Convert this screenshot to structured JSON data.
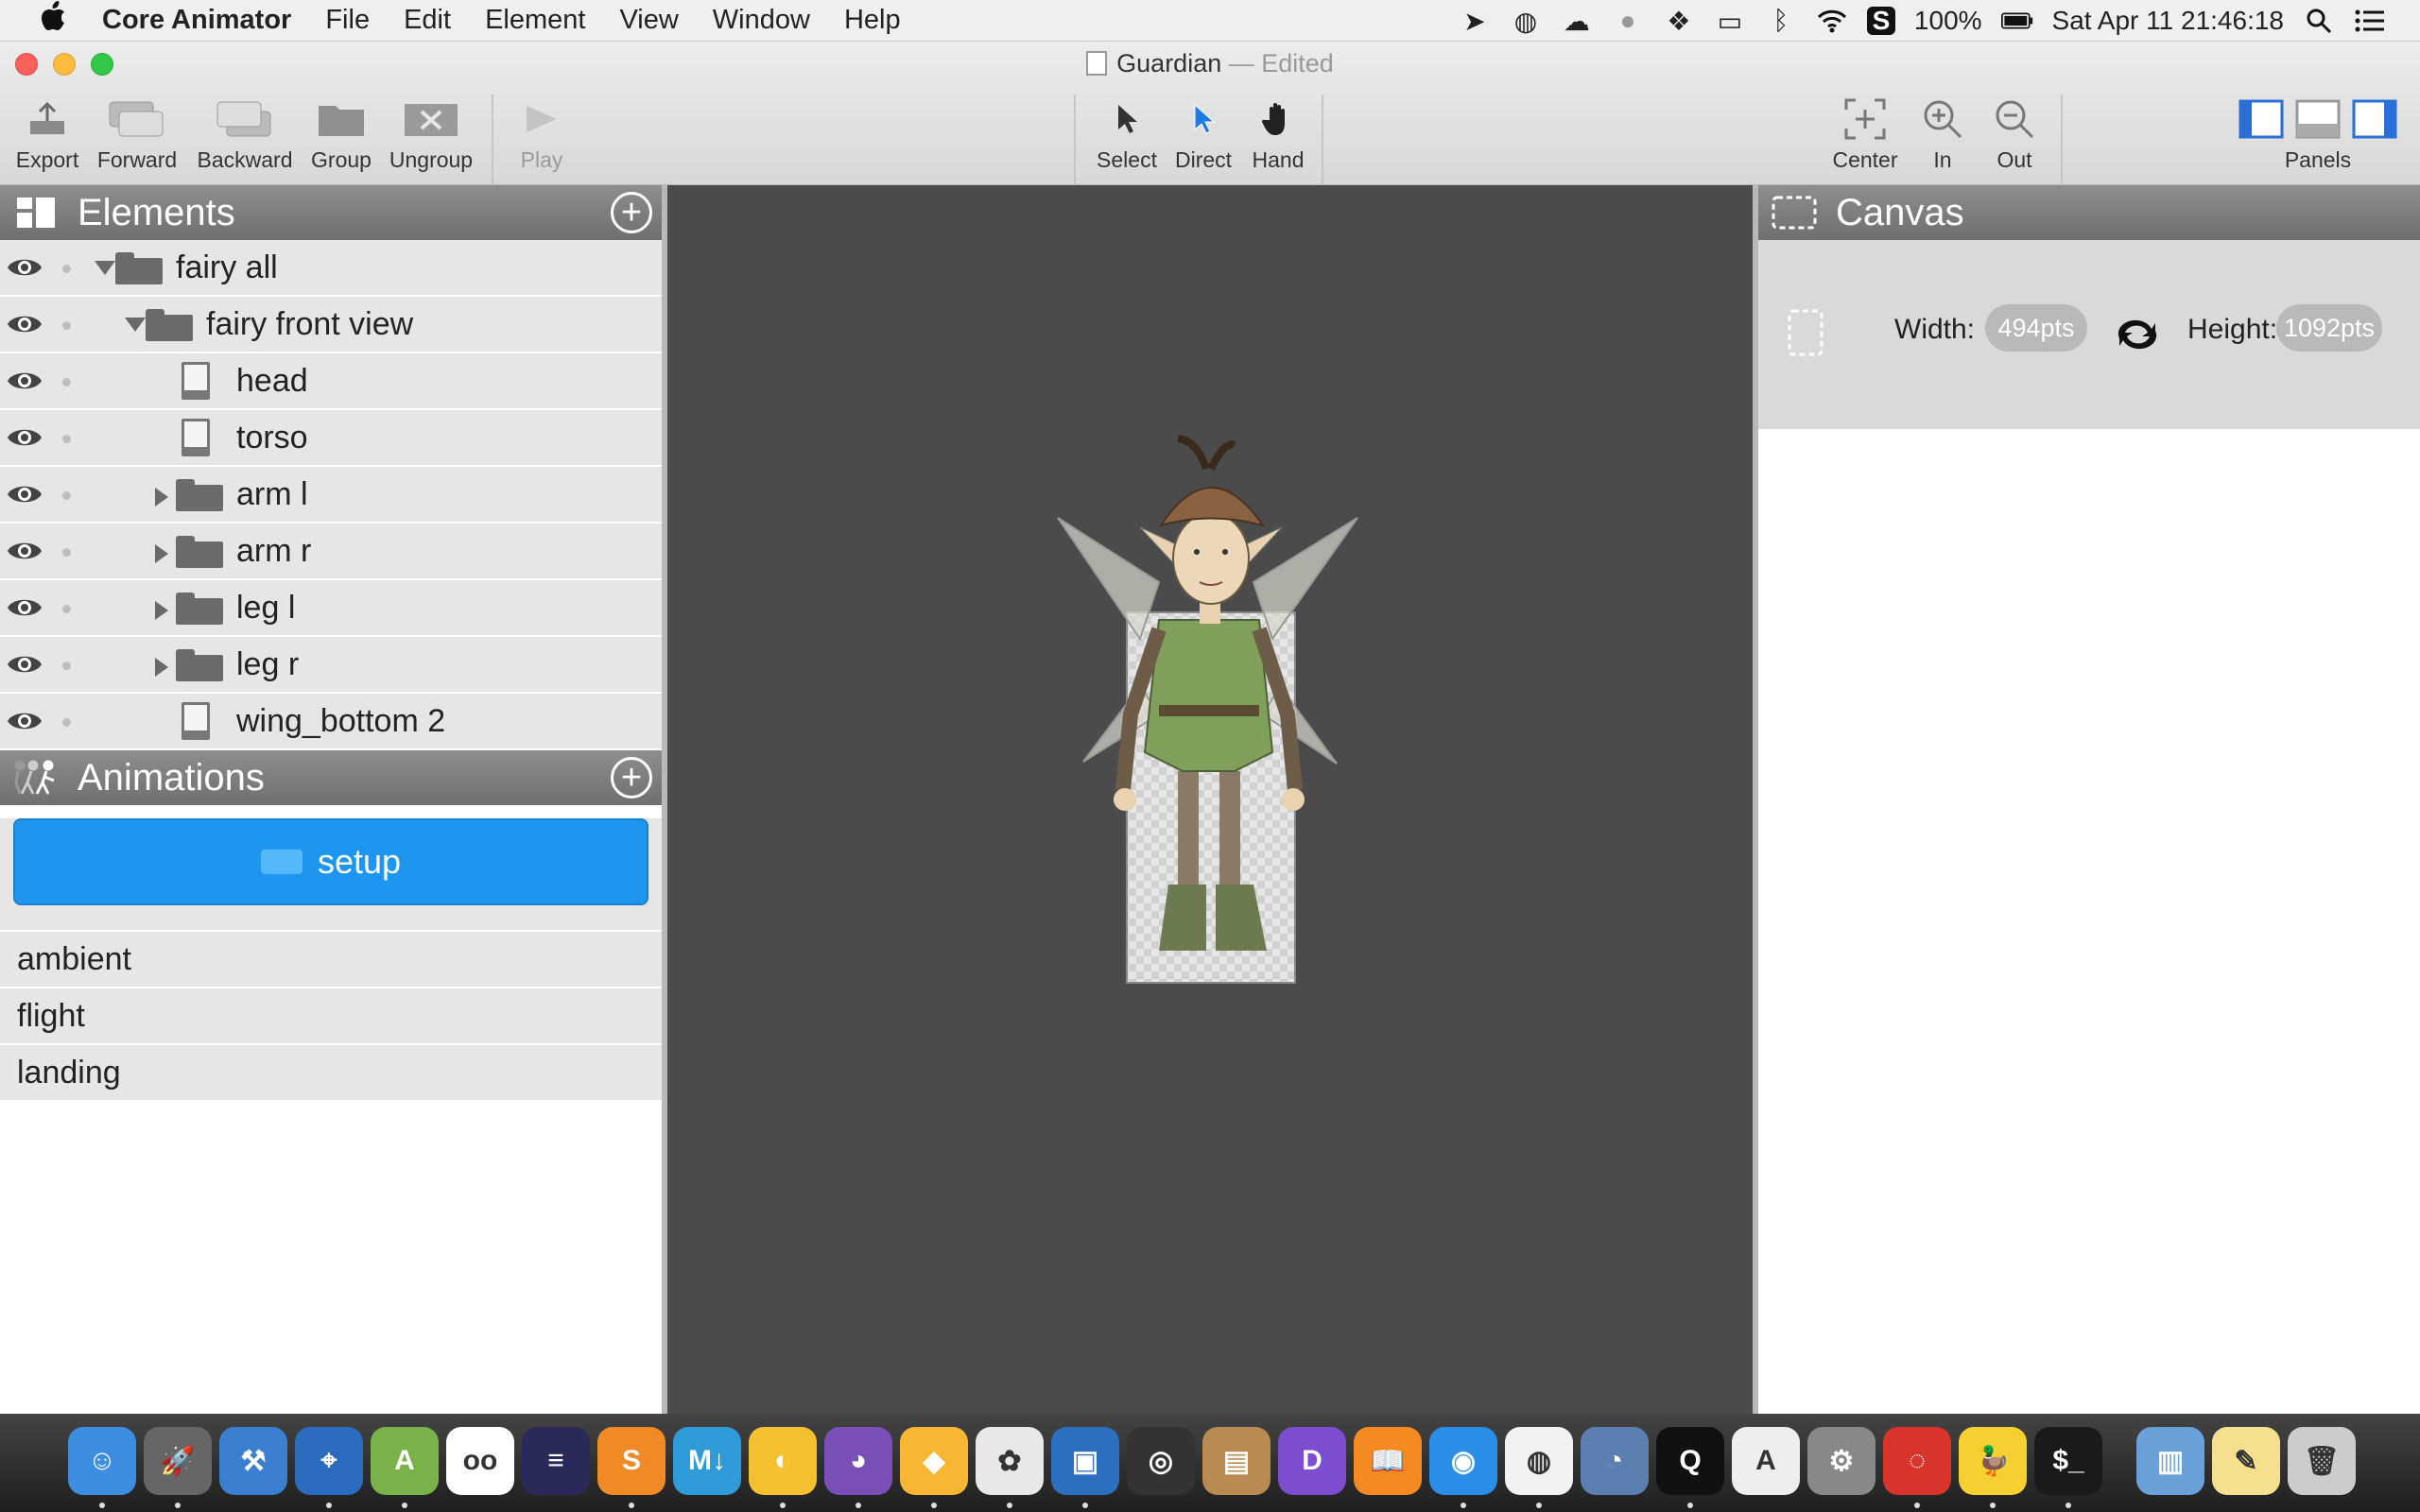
{
  "menubar": {
    "app_name": "Core Animator",
    "menus": [
      "File",
      "Edit",
      "Element",
      "View",
      "Window",
      "Help"
    ],
    "battery": "100%",
    "datetime": "Sat Apr 11  21:46:18"
  },
  "window": {
    "title": "Guardian",
    "title_sep": "—",
    "title_status": "Edited"
  },
  "toolbar": {
    "export": "Export",
    "forward": "Forward",
    "backward": "Backward",
    "group": "Group",
    "ungroup": "Ungroup",
    "play": "Play",
    "select": "Select",
    "direct": "Direct",
    "hand": "Hand",
    "center": "Center",
    "zoom_in": "In",
    "zoom_out": "Out",
    "panels": "Panels"
  },
  "elements_panel": {
    "title": "Elements",
    "items": [
      {
        "label": "fairy all",
        "type": "folder",
        "expanded": true,
        "depth": 0
      },
      {
        "label": "fairy front view",
        "type": "folder",
        "expanded": true,
        "depth": 1
      },
      {
        "label": "head",
        "type": "layer",
        "depth": 2
      },
      {
        "label": "torso",
        "type": "layer",
        "depth": 2
      },
      {
        "label": "arm l",
        "type": "folder",
        "expanded": false,
        "depth": 2
      },
      {
        "label": "arm r",
        "type": "folder",
        "expanded": false,
        "depth": 2
      },
      {
        "label": "leg l",
        "type": "folder",
        "expanded": false,
        "depth": 2
      },
      {
        "label": "leg r",
        "type": "folder",
        "expanded": false,
        "depth": 2
      },
      {
        "label": "wing_bottom 2",
        "type": "layer",
        "depth": 2
      }
    ]
  },
  "animations_panel": {
    "title": "Animations",
    "selected": "setup",
    "items": [
      "ambient",
      "flight",
      "landing"
    ]
  },
  "canvas_panel": {
    "title": "Canvas",
    "width_label": "Width:",
    "width_value": "494pts",
    "height_label": "Height:",
    "height_value": "1092pts"
  },
  "colors": {
    "accent_blue": "#1e96f0",
    "stage_bg": "#4b4b4b",
    "panel_header": "#7f7f7f"
  },
  "dock": {
    "apps": [
      "finder-icon",
      "launchpad-icon",
      "xcode-icon",
      "instruments-icon",
      "android-studio-icon",
      "flickr-icon",
      "eclipse-icon",
      "sublime-text-icon",
      "markdown-icon",
      "yummy-icon",
      "github-icon",
      "sketch-icon",
      "fairy-icon",
      "preview-icon",
      "safari-web-inspector-icon",
      "package-icon",
      "dash-icon",
      "ibooks-icon",
      "safari-icon",
      "chrome-icon",
      "weibo-icon",
      "qq-icon",
      "font-icon",
      "system-preferences-icon",
      "netease-music-icon",
      "cyberduck-icon",
      "terminal-icon",
      "screenshot-icon",
      "document-icon",
      "trash-icon"
    ]
  }
}
